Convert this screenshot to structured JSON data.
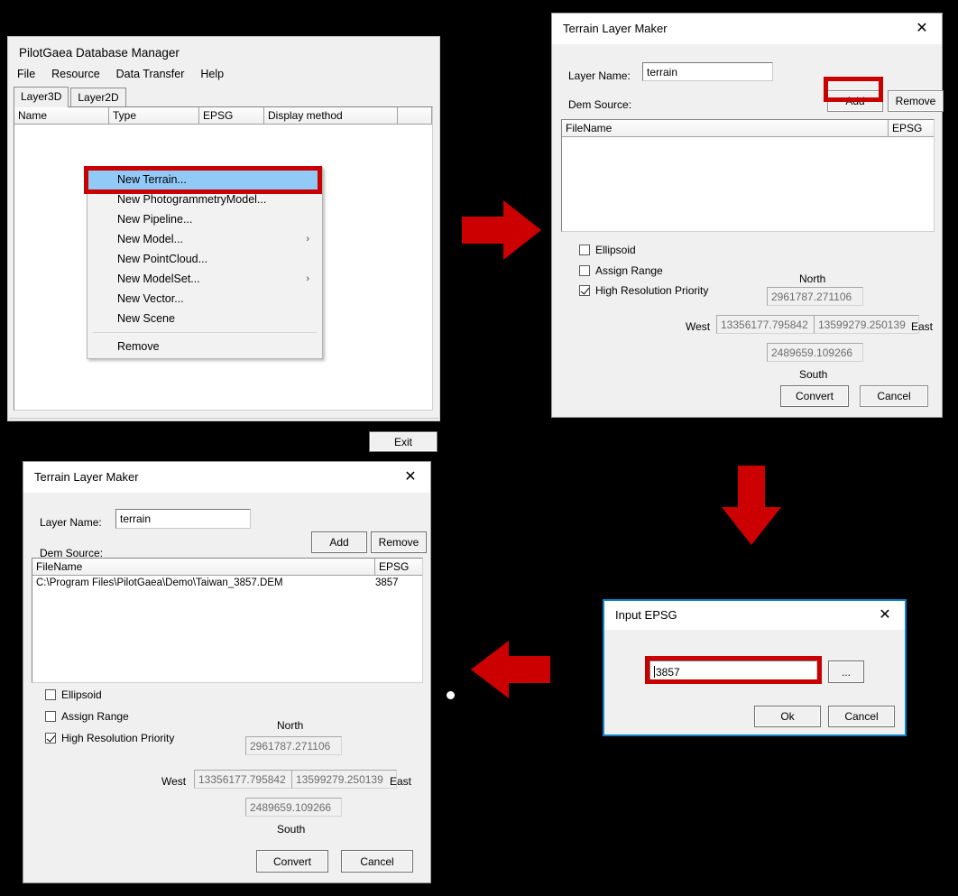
{
  "main_window": {
    "app_title": "PilotGaea Database Manager",
    "menu": [
      "File",
      "Resource",
      "Data Transfer",
      "Help"
    ],
    "tabs": [
      {
        "label": "Layer3D",
        "active": true
      },
      {
        "label": "Layer2D",
        "active": false
      }
    ],
    "columns": [
      "Name",
      "Type",
      "EPSG",
      "Display method",
      ""
    ],
    "rows": [],
    "exit_button": "Exit"
  },
  "context_menu": {
    "items": [
      {
        "label": "New Terrain...",
        "selected": true,
        "submenu": false,
        "separator_before": false
      },
      {
        "label": "New PhotogrammetryModel...",
        "selected": false,
        "submenu": false,
        "separator_before": false
      },
      {
        "label": "New Pipeline...",
        "selected": false,
        "submenu": false,
        "separator_before": false
      },
      {
        "label": "New Model...",
        "selected": false,
        "submenu": true,
        "separator_before": false
      },
      {
        "label": "New PointCloud...",
        "selected": false,
        "submenu": false,
        "separator_before": false
      },
      {
        "label": "New ModelSet...",
        "selected": false,
        "submenu": true,
        "separator_before": false
      },
      {
        "label": "New Vector...",
        "selected": false,
        "submenu": false,
        "separator_before": false
      },
      {
        "label": "New Scene",
        "selected": false,
        "submenu": false,
        "separator_before": false
      },
      {
        "label": "Remove",
        "selected": false,
        "submenu": false,
        "separator_before": true
      }
    ],
    "submenu_glyph": "›"
  },
  "terrain_dialog_empty": {
    "title": "Terrain Layer Maker",
    "close_glyph": "✕",
    "layer_name_label": "Layer Name:",
    "layer_name_value": "terrain",
    "dem_source_label": "Dem Source:",
    "add_button": "Add",
    "remove_button": "Remove",
    "list_columns": [
      "FileName",
      "EPSG"
    ],
    "list_rows": [],
    "checkboxes": [
      {
        "label": "Ellipsoid",
        "checked": false
      },
      {
        "label": "Assign Range",
        "checked": false
      },
      {
        "label": "High Resolution Priority",
        "checked": true
      }
    ],
    "north_label": "North",
    "north_value": "2961787.271106",
    "west_label": "West",
    "west_value": "13356177.795842",
    "east_label": "East",
    "east_value": "13599279.250139",
    "south_label": "South",
    "south_value": "2489659.109266",
    "convert_button": "Convert",
    "cancel_button": "Cancel"
  },
  "terrain_dialog_filled": {
    "title": "Terrain Layer Maker",
    "close_glyph": "✕",
    "layer_name_label": "Layer Name:",
    "layer_name_value": "terrain",
    "dem_source_label": "Dem Source:",
    "add_button": "Add",
    "remove_button": "Remove",
    "list_columns": [
      "FileName",
      "EPSG"
    ],
    "list_rows": [
      {
        "filename": "C:\\Program Files\\PilotGaea\\Demo\\Taiwan_3857.DEM",
        "epsg": "3857"
      }
    ],
    "checkboxes": [
      {
        "label": "Ellipsoid",
        "checked": false
      },
      {
        "label": "Assign Range",
        "checked": false
      },
      {
        "label": "High Resolution Priority",
        "checked": true
      }
    ],
    "north_label": "North",
    "north_value": "2961787.271106",
    "west_label": "West",
    "west_value": "13356177.795842",
    "east_label": "East",
    "east_value": "13599279.250139",
    "south_label": "South",
    "south_value": "2489659.109266",
    "convert_button": "Convert",
    "cancel_button": "Cancel"
  },
  "epsg_dialog": {
    "title": "Input EPSG",
    "close_glyph": "✕",
    "epsg_value": "3857",
    "browse_button": "...",
    "ok_button": "Ok",
    "cancel_button": "Cancel"
  },
  "colors": {
    "annotation_red": "#c80000",
    "arrow_red": "#cc0000",
    "menu_selection_blue": "#91c9f7",
    "dialog_accent_blue": "#0c82c8",
    "background": "#000000"
  }
}
